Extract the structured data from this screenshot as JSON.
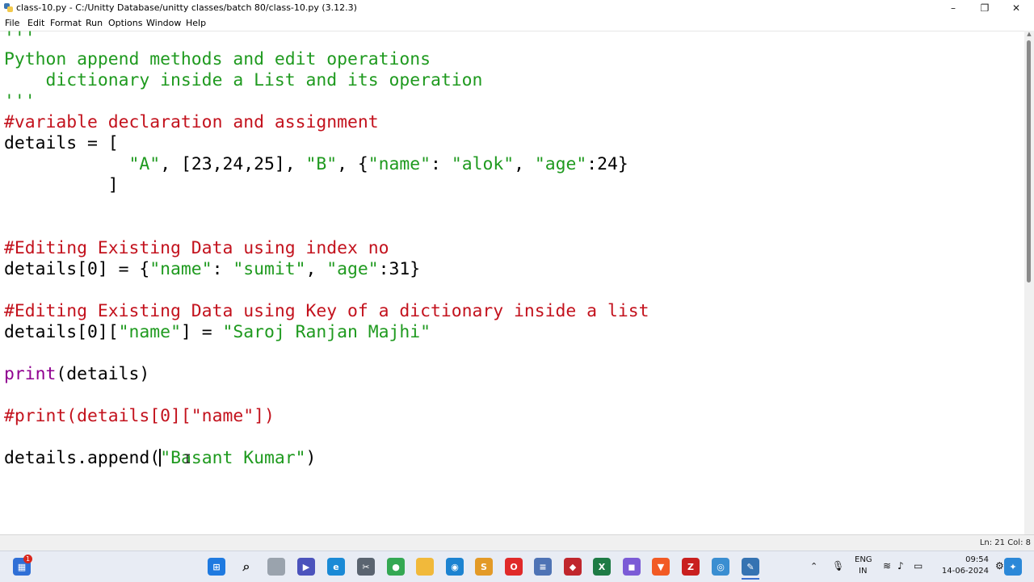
{
  "window": {
    "title": "class-10.py - C:/Unitty Database/unitty classes/batch 80/class-10.py (3.12.3)",
    "controls": {
      "minimize": "–",
      "restore": "❐",
      "close": "✕"
    }
  },
  "menu": [
    "File",
    "Edit",
    "Format",
    "Run",
    "Options",
    "Window",
    "Help"
  ],
  "editor": {
    "lines": [
      "'''",
      "Python append methods and edit operations",
      "    dictionary inside a List and its operation",
      "'''",
      "#variable declaration and assignment",
      "details = [",
      "            \"A\", [23,24,25], \"B\", {\"name\": \"alok\", \"age\":24}",
      "          ]",
      "",
      "",
      "#Editing Existing Data using index no",
      "details[0] = {\"name\": \"sumit\", \"age\":31}",
      "",
      "#Editing Existing Data using Key of a dictionary inside a list",
      "details[0][\"name\"] = \"Saroj Ranjan Majhi\"",
      "",
      "print(details)",
      "",
      "#print(details[0][\"name\"])",
      "",
      "details.append(\"Basant Kumar\")"
    ]
  },
  "status": {
    "position": "Ln: 21   Col: 8"
  },
  "taskbar": {
    "notification_badge": "1",
    "icons": [
      "widgets-icon",
      "start-icon",
      "search-icon",
      "task-view-icon",
      "meet-icon",
      "edge-icon",
      "snipping-icon",
      "chrome-icon",
      "file-explorer-icon",
      "maps-icon",
      "sublime-icon",
      "opera-icon",
      "notepad-icon",
      "app-icon",
      "excel-icon",
      "teams-icon",
      "brave-icon",
      "filezilla-icon",
      "app-icon",
      "idle-icon"
    ],
    "lang_line1": "ENG",
    "lang_line2": "IN",
    "time": "09:54",
    "date": "14-06-2024"
  },
  "colors": {
    "comment": "#c3121d",
    "string": "#1f9a1f",
    "builtin": "#900090",
    "keyword_default": "#000000"
  }
}
